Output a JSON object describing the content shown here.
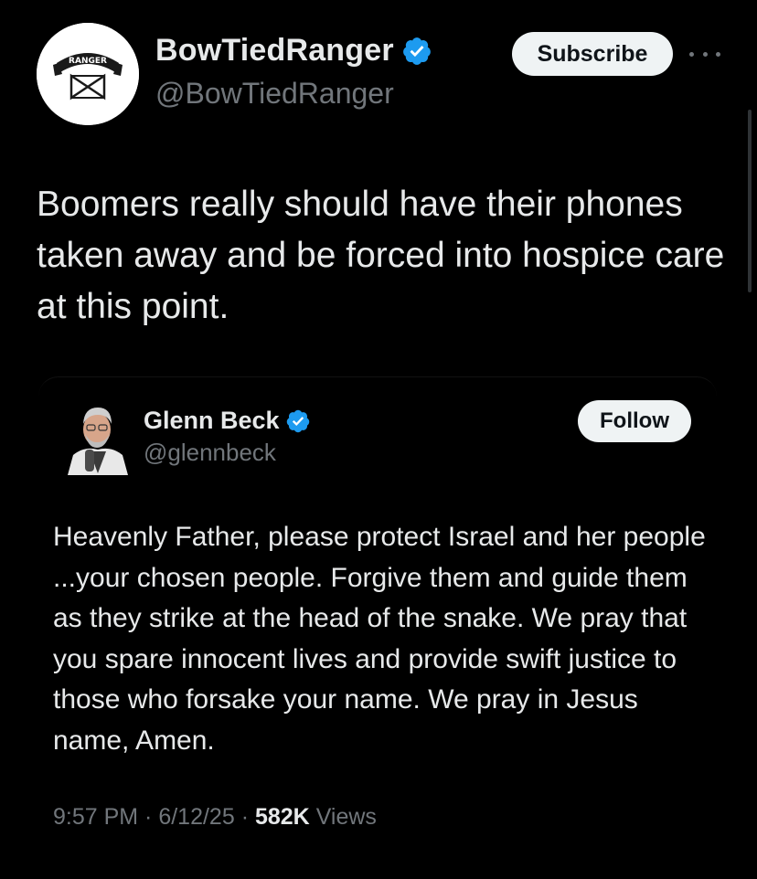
{
  "post": {
    "author": {
      "name": "BowTiedRanger",
      "handle": "@BowTiedRanger",
      "avatar_banner_text": "RANGER",
      "verified": true
    },
    "subscribe_label": "Subscribe",
    "more_icon": "more-horizontal-icon",
    "text": "Boomers really should have their phones taken away and be forced into hospice care at this point."
  },
  "quote": {
    "author": {
      "name": "Glenn Beck",
      "handle": "@glennbeck",
      "verified": true
    },
    "follow_label": "Follow",
    "text": "Heavenly Father, please protect Israel and her people ...your chosen people. Forgive them and guide them as they strike at the head of the snake. We pray that you spare innocent lives and provide swift justice to those who forsake your name. We pray in Jesus name, Amen.",
    "time": "9:57 PM",
    "date": "6/12/25",
    "separator": " · ",
    "views_count": "582K",
    "views_label": "Views"
  },
  "colors": {
    "background": "#000000",
    "text_primary": "#e7e9ea",
    "text_secondary": "#71767b",
    "verified_blue": "#1d9bf0",
    "button_bg": "#eff3f4"
  }
}
